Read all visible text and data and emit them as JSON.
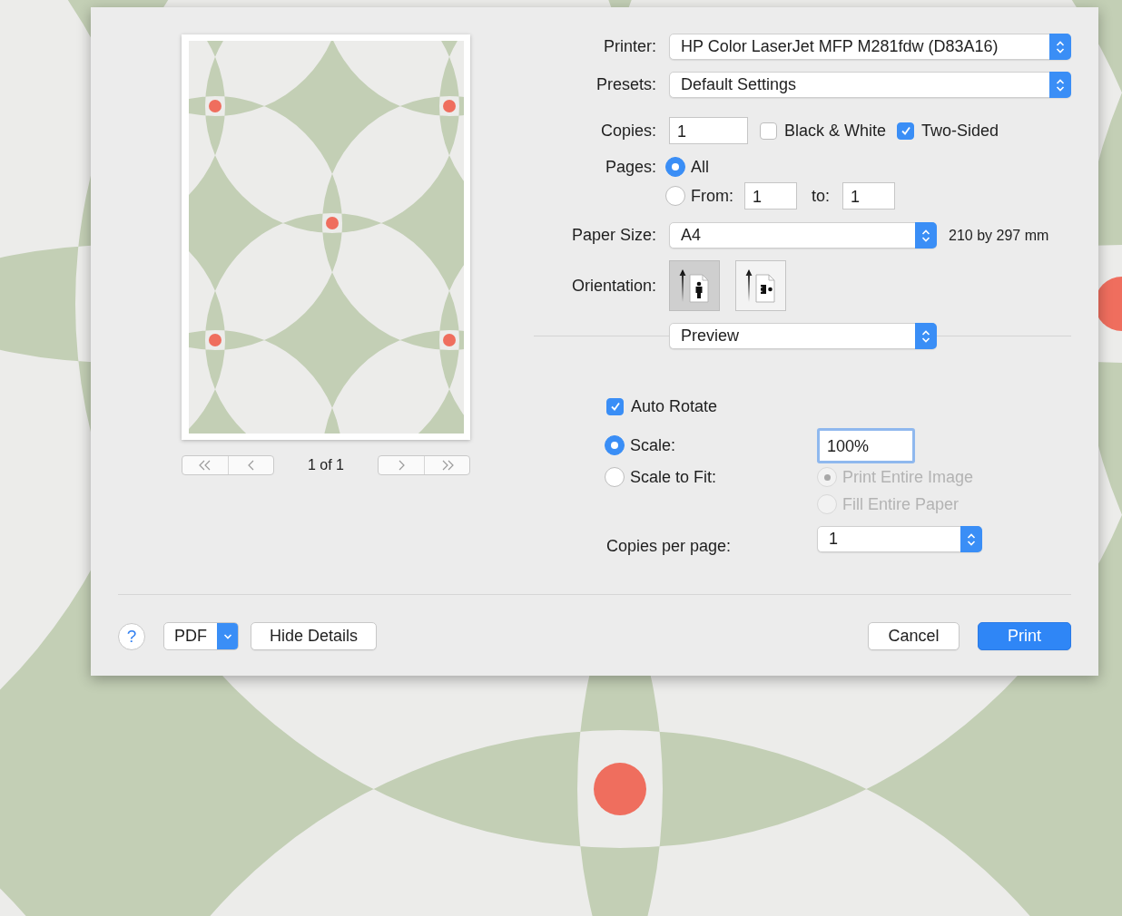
{
  "dialog": {
    "preview": {
      "page_label": "1 of 1"
    },
    "printer": {
      "label": "Printer:",
      "value": "HP Color LaserJet MFP M281fdw (D83A16)"
    },
    "presets": {
      "label": "Presets:",
      "value": "Default Settings"
    },
    "copies": {
      "label": "Copies:",
      "value": "1"
    },
    "options": [
      {
        "label": "Black & White",
        "checked": false
      },
      {
        "label": "Two-Sided",
        "checked": true
      }
    ],
    "pages": {
      "label": "Pages:",
      "choices": [
        {
          "kind": "all",
          "label": "All",
          "selected": true
        },
        {
          "kind": "range",
          "label": "From:",
          "selected": false,
          "from": "1",
          "to_label": "to:",
          "to": "1"
        }
      ]
    },
    "paper_size": {
      "label": "Paper Size:",
      "value": "A4",
      "dimensions": "210 by 297 mm"
    },
    "orientation": {
      "label": "Orientation:",
      "options": [
        {
          "kind": "portrait",
          "selected": true
        },
        {
          "kind": "landscape",
          "selected": false
        }
      ]
    },
    "section_menu": {
      "value": "Preview"
    },
    "auto_rotate": {
      "label": "Auto Rotate",
      "checked": true
    },
    "scale_modes": [
      {
        "label": "Scale:",
        "selected": true,
        "value": "100%",
        "focused": true
      },
      {
        "label": "Scale to Fit:",
        "selected": false
      }
    ],
    "fit_options": [
      {
        "label": "Print Entire Image",
        "selected": true,
        "disabled": true
      },
      {
        "label": "Fill Entire Paper",
        "selected": false,
        "disabled": true
      }
    ],
    "copies_per_page": {
      "label": "Copies per page:",
      "value": "1"
    },
    "footer": {
      "help": "?",
      "pdf": "PDF",
      "hide_details": "Hide Details",
      "cancel": "Cancel",
      "print": "Print"
    }
  }
}
